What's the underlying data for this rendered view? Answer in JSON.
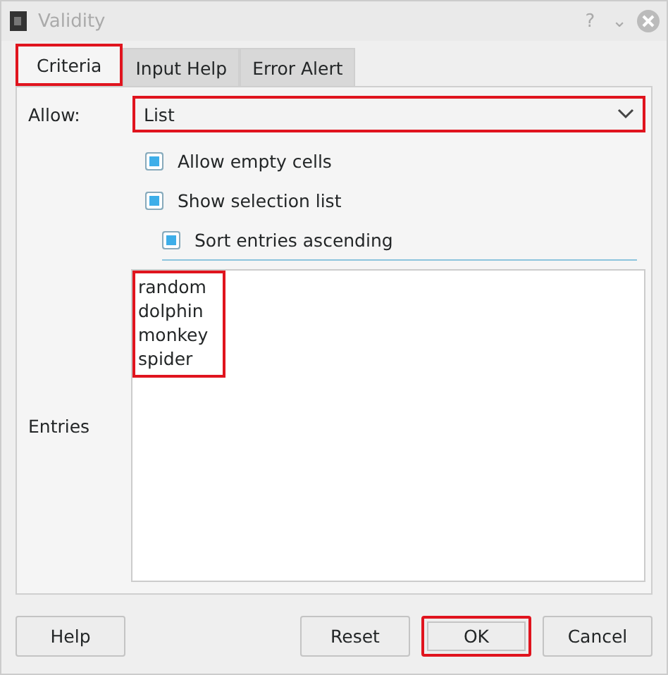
{
  "window": {
    "title": "Validity",
    "controls": [
      "?",
      "⌄"
    ]
  },
  "tabs": [
    {
      "label": "Criteria",
      "selected": true,
      "highlighted": true
    },
    {
      "label": "Input Help",
      "selected": false,
      "highlighted": false
    },
    {
      "label": "Error Alert",
      "selected": false,
      "highlighted": false
    }
  ],
  "allow": {
    "label": "Allow:",
    "value": "List",
    "highlighted": true
  },
  "options": [
    {
      "label": "Allow empty cells",
      "checked": true,
      "indented": false
    },
    {
      "label": "Show selection list",
      "checked": true,
      "indented": false
    },
    {
      "label": "Sort entries ascending",
      "checked": true,
      "indented": true
    }
  ],
  "entries": {
    "label": "Entries",
    "lines": [
      "random",
      "dolphin",
      "monkey",
      "spider"
    ],
    "highlighted": true
  },
  "left_buttons": [
    {
      "label": "Help",
      "highlighted": false
    }
  ],
  "right_buttons": [
    {
      "label": "Reset",
      "highlighted": false
    },
    {
      "label": "OK",
      "highlighted": true
    },
    {
      "label": "Cancel",
      "highlighted": false
    }
  ]
}
